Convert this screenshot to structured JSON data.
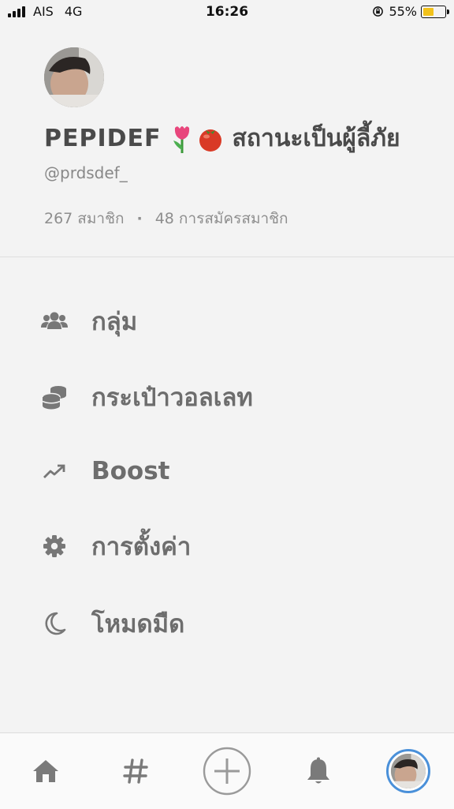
{
  "status_bar": {
    "carrier": "AIS",
    "network": "4G",
    "time": "16:26",
    "battery_percent": "55%",
    "battery_level": 0.55,
    "battery_color": "#f2c21b"
  },
  "profile": {
    "name_latin": "PEPIDEF",
    "name_emojis": [
      "tulip",
      "tomato"
    ],
    "name_thai": "สถานะเป็นผู้ลี้ภัย",
    "handle": "@prdsdef_",
    "members": "267 สมาชิก",
    "separator": "·",
    "subscriptions": "48 การสมัครสมาชิก"
  },
  "menu": {
    "items": [
      {
        "label": "กลุ่ม",
        "icon": "users-icon"
      },
      {
        "label": "กระเป๋าวอลเลท",
        "icon": "coins-icon"
      },
      {
        "label": "Boost",
        "icon": "trending-up-icon"
      },
      {
        "label": "การตั้งค่า",
        "icon": "gear-icon"
      },
      {
        "label": "โหมดมืด",
        "icon": "moon-icon"
      }
    ]
  },
  "tab_bar": {
    "tabs": [
      {
        "icon": "home-icon"
      },
      {
        "icon": "hashtag-icon"
      },
      {
        "icon": "plus-circle-icon"
      },
      {
        "icon": "bell-icon"
      },
      {
        "icon": "profile-avatar"
      }
    ],
    "active_ring_color": "#4a90d9"
  },
  "colors": {
    "background": "#f3f3f3",
    "menu_text": "#6d6d6d",
    "icon": "#777777"
  }
}
